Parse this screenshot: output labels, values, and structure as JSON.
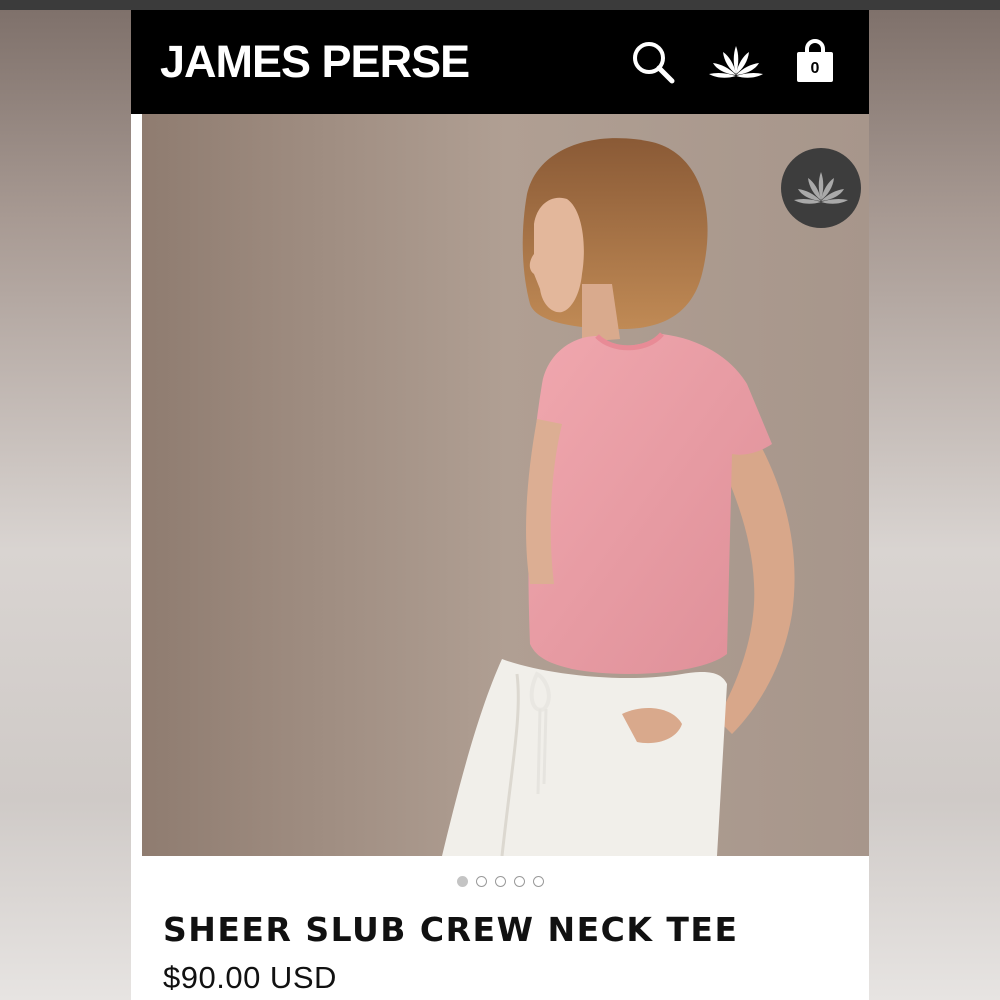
{
  "brand": {
    "logo_text": "JAMES PERSE"
  },
  "header": {
    "icons": [
      "search-icon",
      "lotus-icon",
      "shopping-bag-icon"
    ],
    "cart_count": "0"
  },
  "product": {
    "image_badge_icon": "lotus-icon",
    "carousel": {
      "total": 5,
      "active_index": 0
    },
    "name": "SHEER SLUB CREW NECK TEE",
    "price": "$90.00 USD"
  },
  "colors": {
    "header_bg": "#000000",
    "shirt": "#e89aa2",
    "badge_bg": "#3d3d3d"
  }
}
